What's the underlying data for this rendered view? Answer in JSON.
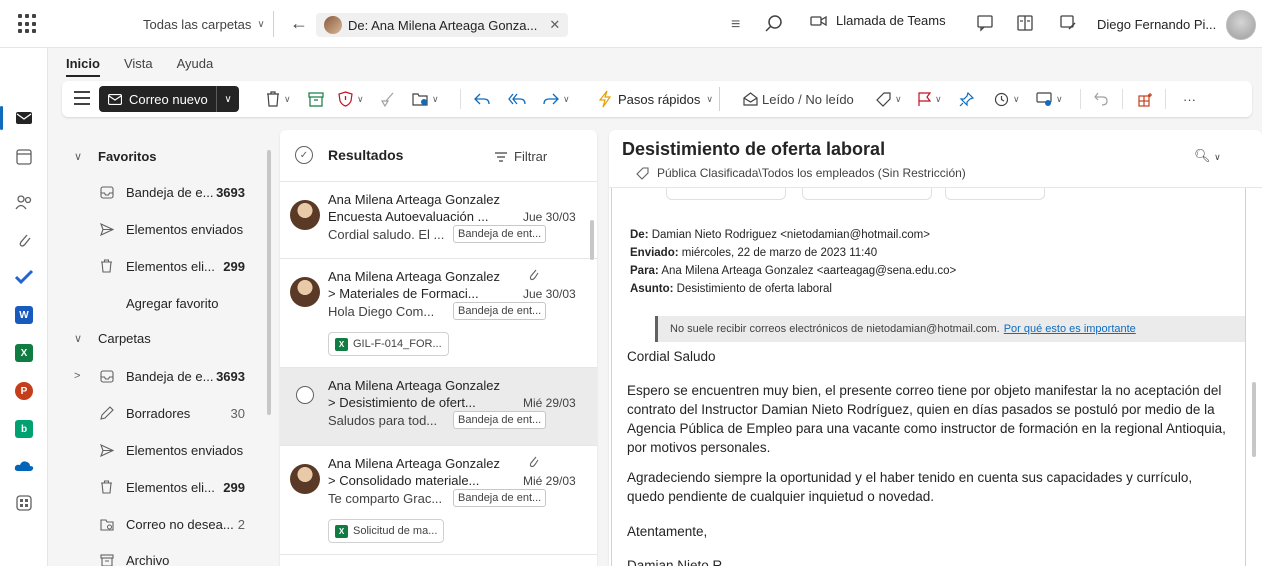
{
  "topbar": {
    "folder_scope": "Todas las carpetas",
    "search_chip": "De: Ana Milena Arteaga Gonza...",
    "teams_label": "Llamada de Teams",
    "user_name": "Diego Fernando Pi..."
  },
  "ribbon": {
    "tabs": [
      "Inicio",
      "Vista",
      "Ayuda"
    ],
    "new_mail": "Correo nuevo",
    "quick_steps": "Pasos rápidos",
    "read_unread": "Leído / No leído",
    "more": "···"
  },
  "folders": {
    "favorites_header": "Favoritos",
    "fav": [
      {
        "name": "Bandeja de e...",
        "count": "3693",
        "icon": "inbox-icon"
      },
      {
        "name": "Elementos enviados",
        "count": "",
        "icon": "send-icon"
      },
      {
        "name": "Elementos eli...",
        "count": "299",
        "icon": "trash-icon"
      }
    ],
    "add_favorite": "Agregar favorito",
    "folders_header": "Carpetas",
    "list": [
      {
        "name": "Bandeja de e...",
        "count": "3693",
        "icon": "inbox-icon"
      },
      {
        "name": "Borradores",
        "count": "30",
        "icon": "draft-icon"
      },
      {
        "name": "Elementos enviados",
        "count": "",
        "icon": "send-icon"
      },
      {
        "name": "Elementos eli...",
        "count": "299",
        "icon": "trash-icon"
      },
      {
        "name": "Correo no desea...",
        "count": "2",
        "icon": "junk-icon"
      },
      {
        "name": "Archivo",
        "count": "",
        "icon": "archive-icon"
      }
    ]
  },
  "messages": {
    "title": "Resultados",
    "filter": "Filtrar",
    "items": [
      {
        "sender": "Ana Milena Arteaga Gonzalez",
        "subject": "Encuesta Autoevaluación ...",
        "date": "Jue 30/03",
        "preview": "Cordial saludo. El ...",
        "tag": "Bandeja de ent..."
      },
      {
        "sender": "Ana Milena Arteaga Gonzalez",
        "subject": "> Materiales de Formaci...",
        "date": "Jue 30/03",
        "preview": "Hola Diego Com...",
        "tag": "Bandeja de ent...",
        "attachment": "GIL-F-014_FOR..."
      },
      {
        "sender": "Ana Milena Arteaga Gonzalez",
        "subject": "> Desistimiento de ofert...",
        "date": "Mié 29/03",
        "preview": "Saludos para tod...",
        "tag": "Bandeja de ent..."
      },
      {
        "sender": "Ana Milena Arteaga Gonzalez",
        "subject": "> Consolidado materiale...",
        "date": "Mié 29/03",
        "preview": "Te comparto Grac...",
        "tag": "Bandeja de ent...",
        "attachment": "Solicitud de ma..."
      }
    ]
  },
  "reading": {
    "subject": "Desistimiento de oferta laboral",
    "classification": "Pública Clasificada\\Todos los empleados (Sin Restricción)",
    "from_label": "De:",
    "from": "Damian Nieto Rodriguez <nietodamian@hotmail.com>",
    "sent_label": "Enviado:",
    "sent": "miércoles, 22 de marzo de 2023 11:40",
    "to_label": "Para:",
    "to": "Ana Milena Arteaga Gonzalez <aarteagag@sena.edu.co>",
    "subject_label": "Asunto:",
    "subject_value": "Desistimiento de oferta laboral",
    "warning": "No suele recibir correos electrónicos de nietodamian@hotmail.com.",
    "warning_link": "Por qué esto es importante",
    "greeting": "Cordial Saludo",
    "p1": "Espero se encuentren muy bien, el presente correo tiene por objeto manifestar la no aceptación del contrato del Instructor Damian Nieto Rodríguez, quien en días pasados se postuló por medio de la Agencia Pública de Empleo para una vacante como instructor de formación en la regional Antioquia, por motivos personales.",
    "p2": "Agradeciendo siempre la oportunidad y el haber tenido en cuenta sus capacidades y currículo, quedo pendiente de cualquier inquietud o novedad.",
    "closing": "Atentamente,",
    "signature": "Damian Nieto R"
  }
}
